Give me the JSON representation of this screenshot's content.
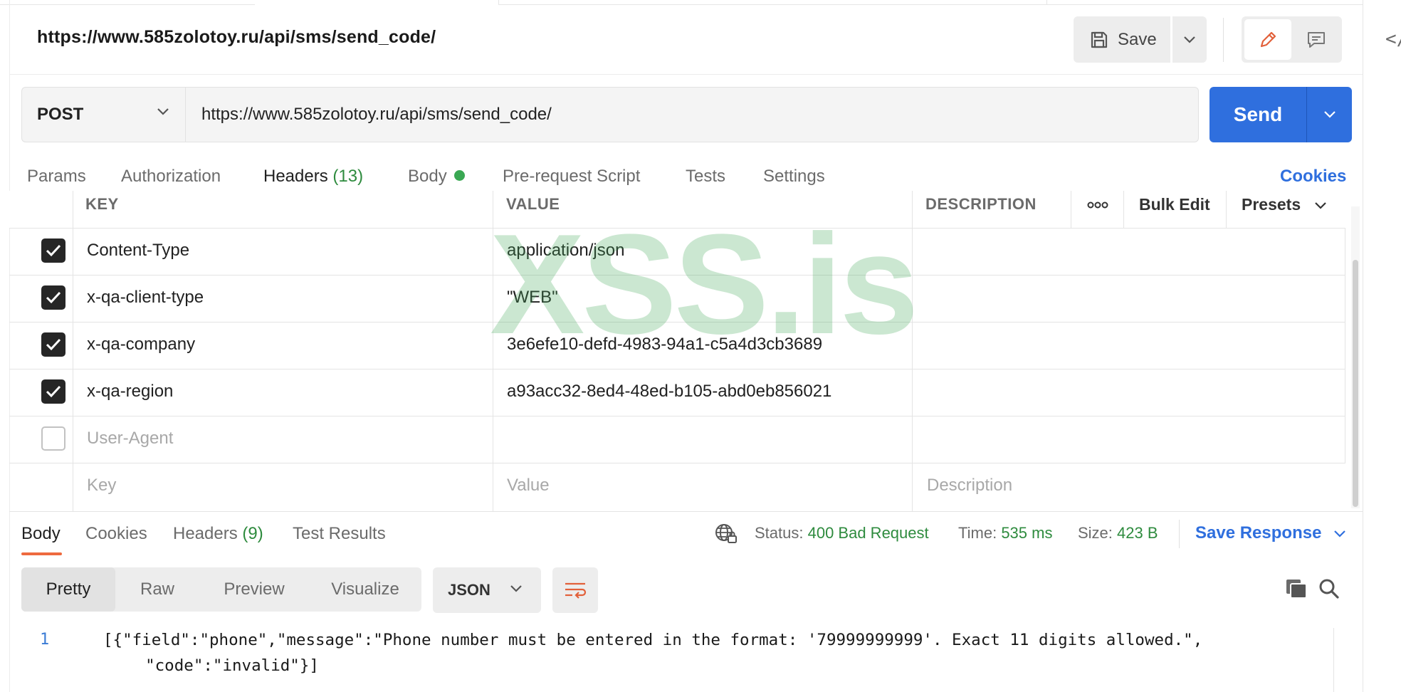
{
  "request": {
    "title": "https://www.585zolotoy.ru/api/sms/send_code/",
    "method": "POST",
    "url": "https://www.585zolotoy.ru/api/sms/send_code/"
  },
  "toolbar": {
    "save_label": "Save",
    "send_label": "Send"
  },
  "request_tabs": [
    {
      "label": "Params"
    },
    {
      "label": "Authorization"
    },
    {
      "label": "Headers",
      "count": "(13)"
    },
    {
      "label": "Body"
    },
    {
      "label": "Pre-request Script"
    },
    {
      "label": "Tests"
    },
    {
      "label": "Settings"
    }
  ],
  "cookies_link": "Cookies",
  "headers_table": {
    "columns": {
      "key": "KEY",
      "value": "VALUE",
      "description": "DESCRIPTION",
      "more": "ooo",
      "bulk_edit": "Bulk Edit",
      "presets": "Presets"
    },
    "rows": [
      {
        "key": "Content-Type",
        "value": "application/json",
        "enabled": true
      },
      {
        "key": "x-qa-client-type",
        "value": "\"WEB\"",
        "enabled": true
      },
      {
        "key": "x-qa-company",
        "value": "3e6efe10-defd-4983-94a1-c5a4d3cb3689",
        "enabled": true
      },
      {
        "key": "x-qa-region",
        "value": "a93acc32-8ed4-48ed-b105-abd0eb856021",
        "enabled": true
      },
      {
        "key": "User-Agent",
        "value": "",
        "enabled": false
      }
    ],
    "placeholders": {
      "key": "Key",
      "value": "Value",
      "description": "Description"
    }
  },
  "watermark": "XSS.is",
  "response": {
    "tabs": [
      {
        "label": "Body"
      },
      {
        "label": "Cookies"
      },
      {
        "label": "Headers",
        "count": "(9)"
      },
      {
        "label": "Test Results"
      }
    ],
    "status_label": "Status:",
    "status_value": "400 Bad Request",
    "time_label": "Time:",
    "time_value": "535 ms",
    "size_label": "Size:",
    "size_value": "423 B",
    "save_response": "Save Response",
    "views": [
      "Pretty",
      "Raw",
      "Preview",
      "Visualize"
    ],
    "format": "JSON",
    "line_number": "1",
    "body_line1": "[{\"field\":\"phone\",\"message\":\"Phone number must be entered in the format: '79999999999'. Exact 11 digits allowed.\",",
    "body_line2": "  \"code\":\"invalid\"}]"
  },
  "colors": {
    "accent": "#2f6fde",
    "tab_underline": "#ee6a3f",
    "status_green": "#2e8b3e"
  },
  "icons": [
    "save-icon",
    "chevron-down-icon",
    "pencil-icon",
    "comment-icon",
    "code-icon",
    "globe-lock-icon",
    "wrap-lines-icon",
    "copy-icon",
    "search-icon",
    "checkbox-checked-icon"
  ]
}
